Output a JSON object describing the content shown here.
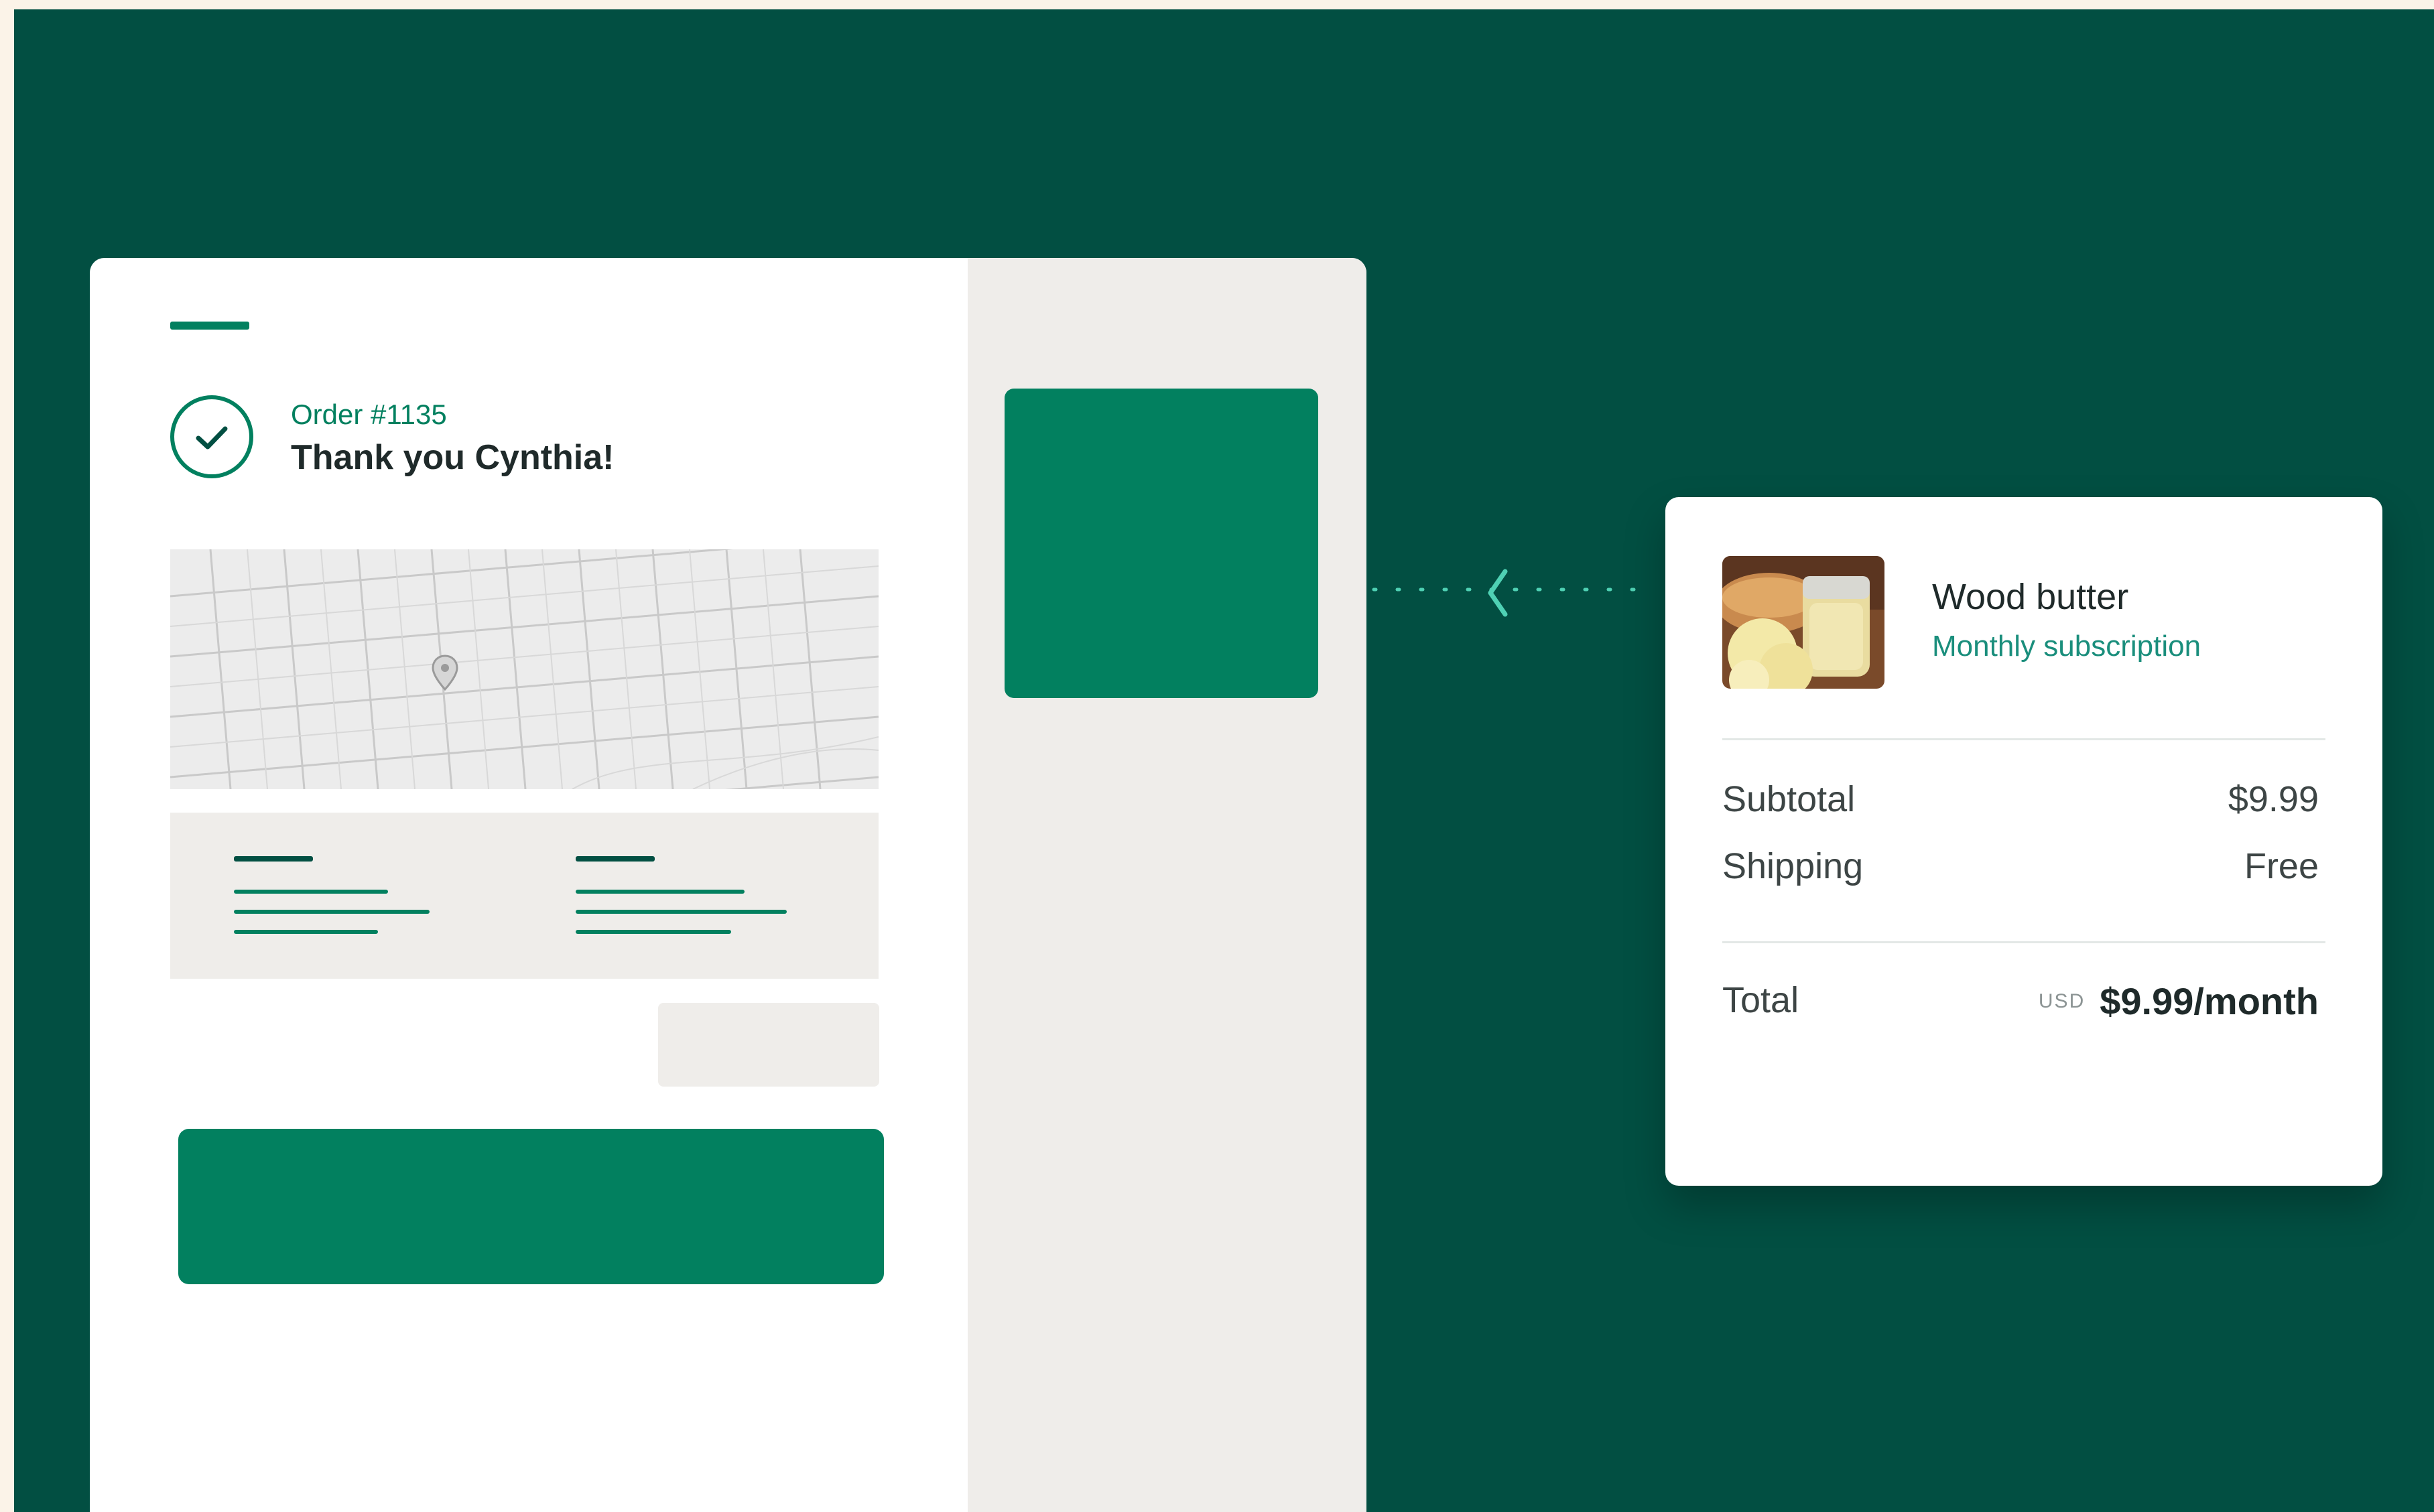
{
  "order": {
    "number_label": "Order #1135",
    "thank_you": "Thank you Cynthia!"
  },
  "product": {
    "name": "Wood butter",
    "subtitle": "Monthly subscription",
    "thumbnail": "product-photo"
  },
  "summary": {
    "subtotal_label": "Subtotal",
    "subtotal_value": "$9.99",
    "shipping_label": "Shipping",
    "shipping_value": "Free",
    "total_label": "Total",
    "currency": "USD",
    "total_value": "$9.99/month"
  },
  "icons": {
    "confirmation": "checkmark-icon",
    "map_pin": "map-pin-icon",
    "connector_arrow": "chevron-left-icon"
  },
  "colors": {
    "background": "#024f42",
    "accent": "#02805f",
    "link": "#1a8e7c",
    "panel": "#efedea",
    "connector": "#4fd1b4"
  }
}
